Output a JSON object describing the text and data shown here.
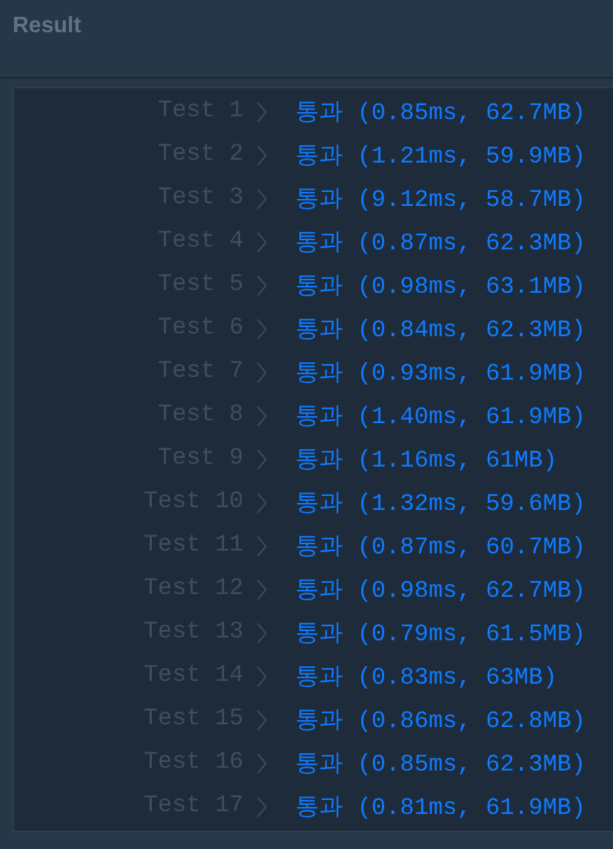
{
  "header": {
    "title": "Result"
  },
  "tests": [
    {
      "label": "Test 1",
      "result": "통과 (0.85ms, 62.7MB)"
    },
    {
      "label": "Test 2",
      "result": "통과 (1.21ms, 59.9MB)"
    },
    {
      "label": "Test 3",
      "result": "통과 (9.12ms, 58.7MB)"
    },
    {
      "label": "Test 4",
      "result": "통과 (0.87ms, 62.3MB)"
    },
    {
      "label": "Test 5",
      "result": "통과 (0.98ms, 63.1MB)"
    },
    {
      "label": "Test 6",
      "result": "통과 (0.84ms, 62.3MB)"
    },
    {
      "label": "Test 7",
      "result": "통과 (0.93ms, 61.9MB)"
    },
    {
      "label": "Test 8",
      "result": "통과 (1.40ms, 61.9MB)"
    },
    {
      "label": "Test 9",
      "result": "통과 (1.16ms, 61MB)"
    },
    {
      "label": "Test 10",
      "result": "통과 (1.32ms, 59.6MB)"
    },
    {
      "label": "Test 11",
      "result": "통과 (0.87ms, 60.7MB)"
    },
    {
      "label": "Test 12",
      "result": "통과 (0.98ms, 62.7MB)"
    },
    {
      "label": "Test 13",
      "result": "통과 (0.79ms, 61.5MB)"
    },
    {
      "label": "Test 14",
      "result": "통과 (0.83ms, 63MB)"
    },
    {
      "label": "Test 15",
      "result": "통과 (0.86ms, 62.8MB)"
    },
    {
      "label": "Test 16",
      "result": "통과 (0.85ms, 62.3MB)"
    },
    {
      "label": "Test 17",
      "result": "통과 (0.81ms, 61.9MB)"
    }
  ]
}
